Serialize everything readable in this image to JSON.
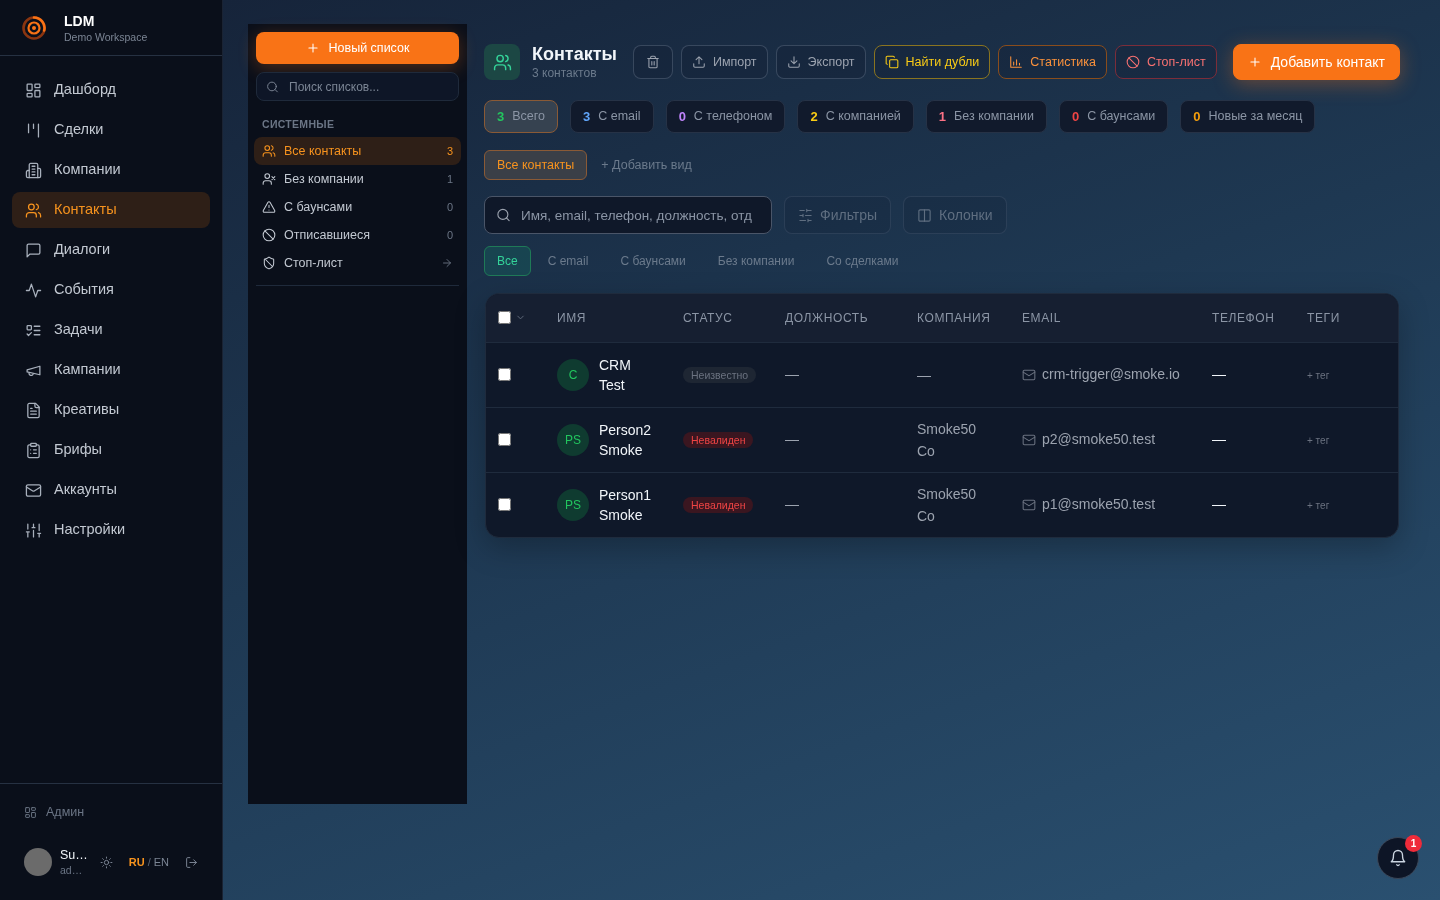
{
  "sidebar": {
    "brand": {
      "name": "LDM",
      "workspace": "Demo Workspace"
    },
    "items": [
      {
        "label": "Дашборд",
        "selected": false
      },
      {
        "label": "Сделки",
        "selected": false
      },
      {
        "label": "Компании",
        "selected": false
      },
      {
        "label": "Контакты",
        "selected": true
      },
      {
        "label": "Диалоги",
        "selected": false
      },
      {
        "label": "События",
        "selected": false
      },
      {
        "label": "Задачи",
        "selected": false
      },
      {
        "label": "Кампании",
        "selected": false
      },
      {
        "label": "Креативы",
        "selected": false
      },
      {
        "label": "Брифы",
        "selected": false
      },
      {
        "label": "Аккаунты",
        "selected": false
      },
      {
        "label": "Настройки",
        "selected": false
      }
    ],
    "admin": {
      "label": "Админ"
    },
    "user": {
      "name": "Su…",
      "email": "ad…"
    },
    "languages": [
      {
        "label": "RU",
        "selected": true
      },
      {
        "label": "EN",
        "selected": false
      }
    ],
    "language_separator": "/"
  },
  "lists_panel": {
    "new_list_button": "Новый список",
    "search": {
      "placeholder": "Поиск списков..."
    },
    "section_title": "СИСТЕМНЫЕ",
    "items": [
      {
        "label": "Все контакты",
        "kind": "count",
        "count": "3",
        "selected": true
      },
      {
        "label": "Без компании",
        "kind": "count",
        "count": "1",
        "selected": false
      },
      {
        "label": "С баунсами",
        "kind": "count",
        "count": "0",
        "selected": false
      },
      {
        "label": "Отписавшиеся",
        "kind": "count",
        "count": "0",
        "selected": false
      },
      {
        "label": "Стоп-лист",
        "kind": "link",
        "selected": false
      }
    ]
  },
  "header": {
    "title": "Контакты",
    "subtitle": "3 контактов",
    "buttons": [
      {
        "label": "Импорт",
        "kind": "neutral"
      },
      {
        "label": "Экспорт",
        "kind": "neutral"
      },
      {
        "label": "Найти дубли",
        "kind": "warning"
      },
      {
        "label": "Статистика",
        "kind": "accent"
      },
      {
        "label": "Стоп-лист",
        "kind": "danger"
      },
      {
        "label": "Добавить контакт",
        "kind": "primary"
      }
    ]
  },
  "stats": [
    {
      "count": "3",
      "label": "Всего",
      "color": "#22c55e",
      "selected": true
    },
    {
      "count": "3",
      "label": "С email",
      "color": "#60a5fa",
      "selected": false
    },
    {
      "count": "0",
      "label": "С телефоном",
      "color": "#c084fc",
      "selected": false
    },
    {
      "count": "2",
      "label": "С компанией",
      "color": "#facc15",
      "selected": false
    },
    {
      "count": "1",
      "label": "Без компании",
      "color": "#fb7185",
      "selected": false
    },
    {
      "count": "0",
      "label": "С баунсами",
      "color": "#ef4444",
      "selected": false
    },
    {
      "count": "0",
      "label": "Новые за месяц",
      "color": "#f59e0b",
      "selected": false
    }
  ],
  "views": {
    "items": [
      {
        "label": "Все контакты",
        "selected": true
      }
    ],
    "add_view": "+ Добавить вид"
  },
  "search": {
    "placeholder": "Имя, email, телефон, должность, отд"
  },
  "filters_button": "Фильтры",
  "columns_button": "Колонки",
  "quick_filters": [
    {
      "label": "Все",
      "selected": true
    },
    {
      "label": "С email",
      "selected": false
    },
    {
      "label": "С баунсами",
      "selected": false
    },
    {
      "label": "Без компании",
      "selected": false
    },
    {
      "label": "Со сделками",
      "selected": false
    }
  ],
  "table": {
    "select_all": {
      "checked": false
    },
    "columns": [
      "ИМЯ",
      "СТАТУС",
      "ДОЛЖНОСТЬ",
      "КОМПАНИЯ",
      "EMAIL",
      "ТЕЛЕФОН",
      "ТЕГИ"
    ],
    "rows": [
      {
        "checked": false,
        "initials": "C",
        "name": "CRM Test",
        "status": {
          "label": "Неизвестно",
          "kind": "unknown"
        },
        "position": "—",
        "company": "—",
        "email": "crm-trigger@smoke.io",
        "phone": "—",
        "tags": "+ тег"
      },
      {
        "checked": false,
        "initials": "PS",
        "name": "Person2 Smoke",
        "status": {
          "label": "Невалиден",
          "kind": "invalid"
        },
        "position": "—",
        "company": "Smoke50 Co",
        "email": "p2@smoke50.test",
        "phone": "—",
        "tags": "+ тег"
      },
      {
        "checked": false,
        "initials": "PS",
        "name": "Person1 Smoke",
        "status": {
          "label": "Невалиден",
          "kind": "invalid"
        },
        "position": "—",
        "company": "Smoke50 Co",
        "email": "p1@smoke50.test",
        "phone": "—",
        "tags": "+ тег"
      }
    ]
  },
  "notifications": {
    "count": "1"
  }
}
